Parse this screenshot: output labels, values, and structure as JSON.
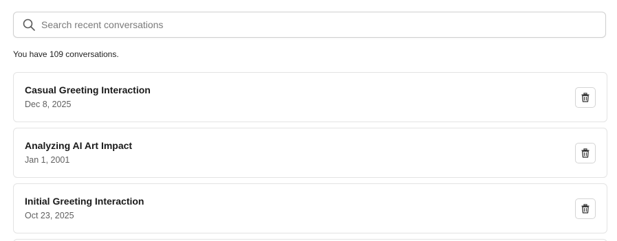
{
  "search": {
    "placeholder": "Search recent conversations",
    "value": "",
    "icon": "search-icon"
  },
  "summary": {
    "count_text": "You have 109 conversations."
  },
  "conversations": [
    {
      "title": "Casual Greeting Interaction",
      "date": "Dec 8, 2025",
      "action_icon": "trash-icon"
    },
    {
      "title": "Analyzing AI Art Impact",
      "date": "Jan 1, 2001",
      "action_icon": "trash-icon"
    },
    {
      "title": "Initial Greeting Interaction",
      "date": "Oct 23, 2025",
      "action_icon": "trash-icon"
    }
  ],
  "colors": {
    "border": "#e3e3e3",
    "title": "#1a1a1a",
    "date": "#5f5f5f",
    "placeholder": "#7a7a7a"
  }
}
